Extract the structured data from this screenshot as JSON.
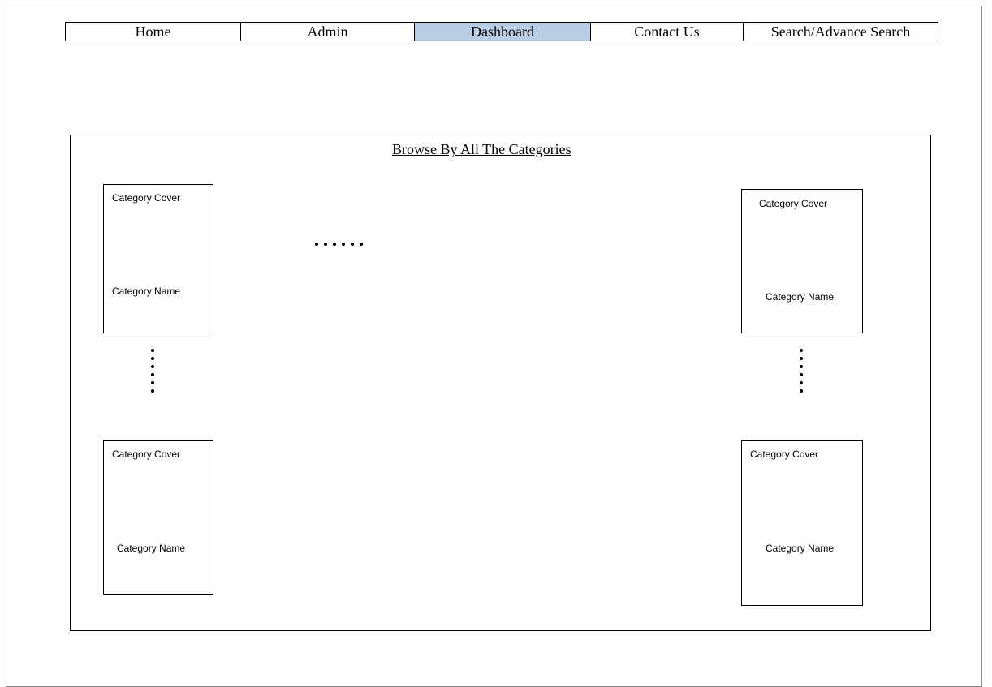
{
  "nav": {
    "items": [
      {
        "label": "Home"
      },
      {
        "label": "Admin"
      },
      {
        "label": "Dashboard",
        "active": true
      },
      {
        "label": "Contact Us"
      },
      {
        "label": "Search/Advance Search"
      }
    ],
    "active_color": "#b8cce4"
  },
  "browse": {
    "title": "Browse By All The Categories",
    "cards": [
      {
        "cover_label": "Category Cover",
        "name_label": "Category Name"
      },
      {
        "cover_label": "Category Cover",
        "name_label": "Category Name"
      },
      {
        "cover_label": "Category Cover",
        "name_label": "Category Name"
      },
      {
        "cover_label": "Category Cover",
        "name_label": "Category Name"
      }
    ]
  }
}
